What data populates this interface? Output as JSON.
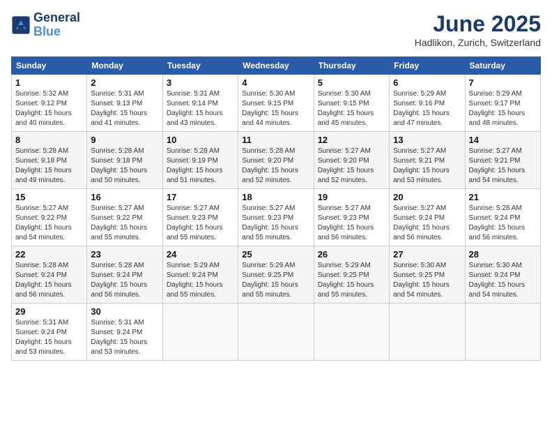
{
  "header": {
    "logo_line1": "General",
    "logo_line2": "Blue",
    "title": "June 2025",
    "subtitle": "Hadlikon, Zurich, Switzerland"
  },
  "weekdays": [
    "Sunday",
    "Monday",
    "Tuesday",
    "Wednesday",
    "Thursday",
    "Friday",
    "Saturday"
  ],
  "weeks": [
    [
      {
        "day": "1",
        "info": "Sunrise: 5:32 AM\nSunset: 9:12 PM\nDaylight: 15 hours\nand 40 minutes."
      },
      {
        "day": "2",
        "info": "Sunrise: 5:31 AM\nSunset: 9:13 PM\nDaylight: 15 hours\nand 41 minutes."
      },
      {
        "day": "3",
        "info": "Sunrise: 5:31 AM\nSunset: 9:14 PM\nDaylight: 15 hours\nand 43 minutes."
      },
      {
        "day": "4",
        "info": "Sunrise: 5:30 AM\nSunset: 9:15 PM\nDaylight: 15 hours\nand 44 minutes."
      },
      {
        "day": "5",
        "info": "Sunrise: 5:30 AM\nSunset: 9:15 PM\nDaylight: 15 hours\nand 45 minutes."
      },
      {
        "day": "6",
        "info": "Sunrise: 5:29 AM\nSunset: 9:16 PM\nDaylight: 15 hours\nand 47 minutes."
      },
      {
        "day": "7",
        "info": "Sunrise: 5:29 AM\nSunset: 9:17 PM\nDaylight: 15 hours\nand 48 minutes."
      }
    ],
    [
      {
        "day": "8",
        "info": "Sunrise: 5:28 AM\nSunset: 9:18 PM\nDaylight: 15 hours\nand 49 minutes."
      },
      {
        "day": "9",
        "info": "Sunrise: 5:28 AM\nSunset: 9:18 PM\nDaylight: 15 hours\nand 50 minutes."
      },
      {
        "day": "10",
        "info": "Sunrise: 5:28 AM\nSunset: 9:19 PM\nDaylight: 15 hours\nand 51 minutes."
      },
      {
        "day": "11",
        "info": "Sunrise: 5:28 AM\nSunset: 9:20 PM\nDaylight: 15 hours\nand 52 minutes."
      },
      {
        "day": "12",
        "info": "Sunrise: 5:27 AM\nSunset: 9:20 PM\nDaylight: 15 hours\nand 52 minutes."
      },
      {
        "day": "13",
        "info": "Sunrise: 5:27 AM\nSunset: 9:21 PM\nDaylight: 15 hours\nand 53 minutes."
      },
      {
        "day": "14",
        "info": "Sunrise: 5:27 AM\nSunset: 9:21 PM\nDaylight: 15 hours\nand 54 minutes."
      }
    ],
    [
      {
        "day": "15",
        "info": "Sunrise: 5:27 AM\nSunset: 9:22 PM\nDaylight: 15 hours\nand 54 minutes."
      },
      {
        "day": "16",
        "info": "Sunrise: 5:27 AM\nSunset: 9:22 PM\nDaylight: 15 hours\nand 55 minutes."
      },
      {
        "day": "17",
        "info": "Sunrise: 5:27 AM\nSunset: 9:23 PM\nDaylight: 15 hours\nand 55 minutes."
      },
      {
        "day": "18",
        "info": "Sunrise: 5:27 AM\nSunset: 9:23 PM\nDaylight: 15 hours\nand 55 minutes."
      },
      {
        "day": "19",
        "info": "Sunrise: 5:27 AM\nSunset: 9:23 PM\nDaylight: 15 hours\nand 56 minutes."
      },
      {
        "day": "20",
        "info": "Sunrise: 5:27 AM\nSunset: 9:24 PM\nDaylight: 15 hours\nand 56 minutes."
      },
      {
        "day": "21",
        "info": "Sunrise: 5:28 AM\nSunset: 9:24 PM\nDaylight: 15 hours\nand 56 minutes."
      }
    ],
    [
      {
        "day": "22",
        "info": "Sunrise: 5:28 AM\nSunset: 9:24 PM\nDaylight: 15 hours\nand 56 minutes."
      },
      {
        "day": "23",
        "info": "Sunrise: 5:28 AM\nSunset: 9:24 PM\nDaylight: 15 hours\nand 56 minutes."
      },
      {
        "day": "24",
        "info": "Sunrise: 5:29 AM\nSunset: 9:24 PM\nDaylight: 15 hours\nand 55 minutes."
      },
      {
        "day": "25",
        "info": "Sunrise: 5:29 AM\nSunset: 9:25 PM\nDaylight: 15 hours\nand 55 minutes."
      },
      {
        "day": "26",
        "info": "Sunrise: 5:29 AM\nSunset: 9:25 PM\nDaylight: 15 hours\nand 55 minutes."
      },
      {
        "day": "27",
        "info": "Sunrise: 5:30 AM\nSunset: 9:25 PM\nDaylight: 15 hours\nand 54 minutes."
      },
      {
        "day": "28",
        "info": "Sunrise: 5:30 AM\nSunset: 9:24 PM\nDaylight: 15 hours\nand 54 minutes."
      }
    ],
    [
      {
        "day": "29",
        "info": "Sunrise: 5:31 AM\nSunset: 9:24 PM\nDaylight: 15 hours\nand 53 minutes."
      },
      {
        "day": "30",
        "info": "Sunrise: 5:31 AM\nSunset: 9:24 PM\nDaylight: 15 hours\nand 53 minutes."
      },
      {
        "day": "",
        "info": ""
      },
      {
        "day": "",
        "info": ""
      },
      {
        "day": "",
        "info": ""
      },
      {
        "day": "",
        "info": ""
      },
      {
        "day": "",
        "info": ""
      }
    ]
  ]
}
